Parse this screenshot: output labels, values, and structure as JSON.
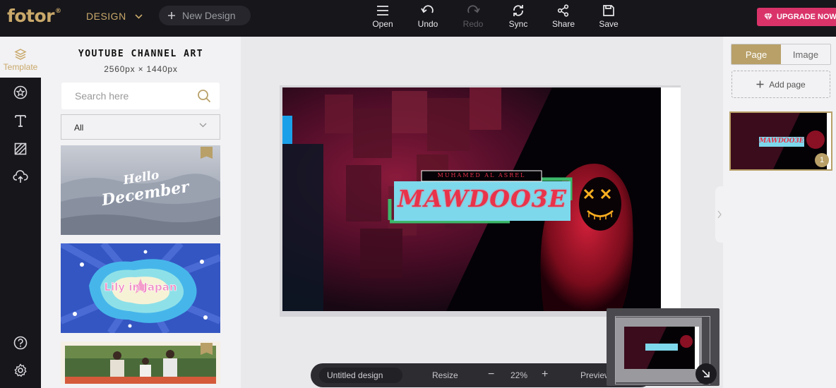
{
  "app": {
    "logo": "fotor",
    "logo_mark": "®",
    "design_menu": "DESIGN",
    "new_design": "New Design",
    "upgrade": "UPGRADE NOW"
  },
  "toolbar": {
    "open": "Open",
    "undo": "Undo",
    "redo": "Redo",
    "sync": "Sync",
    "share": "Share",
    "save": "Save"
  },
  "rail": {
    "template_label": "Template",
    "items": [
      "template-icon",
      "star-icon",
      "text-icon",
      "texture-icon",
      "cloud-upload-icon"
    ],
    "bottom": [
      "help-icon",
      "settings-icon"
    ]
  },
  "panel": {
    "title": "YOUTUBE CHANNEL ART",
    "size": "2560px × 1440px",
    "search_placeholder": "Search here",
    "filter_value": "All",
    "templates": [
      {
        "text_line1": "Hello",
        "text_line2": "December"
      },
      {
        "text": "Lily in Japan"
      },
      {
        "text": ""
      }
    ]
  },
  "artwork": {
    "name_tag": "MUHAMED AL ASREL",
    "headline": "MAWDOO3E"
  },
  "bottombar": {
    "design_name": "Untitled design",
    "resize": "Resize",
    "zoom_out": "−",
    "zoom": "22%",
    "zoom_in": "+",
    "preview": "Preview"
  },
  "rightpanel": {
    "tab_page": "Page",
    "tab_image": "Image",
    "add_page": "Add page",
    "page_number": "1"
  },
  "colors": {
    "topbar": "#16161b",
    "gold": "#c9a86a",
    "upgrade": "#d9336a",
    "panel_bg": "#f2f2f4",
    "canvas_bg": "#e9e9ec",
    "headline_box": "#7ed8ec",
    "headline_text": "#e8334a",
    "frame_green": "#3cb86a"
  }
}
